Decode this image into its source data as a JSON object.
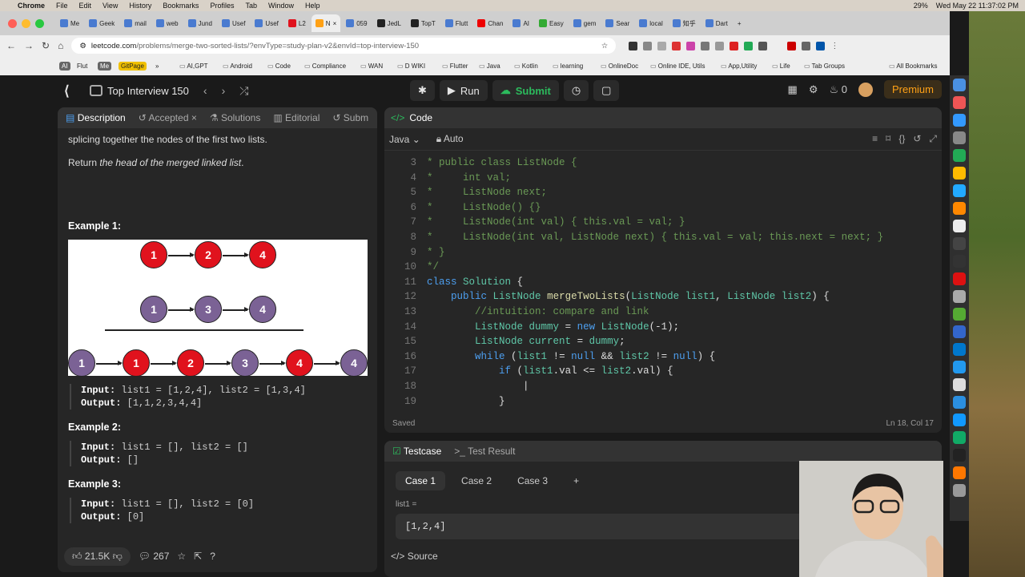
{
  "menubar": {
    "app": "Chrome",
    "items": [
      "File",
      "Edit",
      "View",
      "History",
      "Bookmarks",
      "Profiles",
      "Tab",
      "Window",
      "Help"
    ],
    "battery": "29%",
    "datetime": "Wed May 22 11:37:02 PM"
  },
  "tabs": [
    "Me",
    "Geek",
    "mail",
    "web",
    "Jund",
    "Usef",
    "Usef",
    "L2",
    "N",
    "059",
    "JedL",
    "TopT",
    "Flutt",
    "Chan",
    "AI",
    "Easy",
    "gem",
    "Sear",
    "local",
    "知乎",
    "Dart"
  ],
  "address": {
    "host": "leetcode.com",
    "path": "/problems/merge-two-sorted-lists/?envType=study-plan-v2&envId=top-interview-150"
  },
  "bookmarks": [
    "AI",
    "Flut",
    "Me",
    "GitPage",
    "AI,GPT",
    "Android",
    "Code",
    "Compliance",
    "WAN",
    "D WIKI",
    "Flutter",
    "Java",
    "Kotlin",
    "learning",
    "OnlineDoc",
    "Online IDE, Utils",
    "App,Utility",
    "Life",
    "Tab Groups",
    "All Bookmarks"
  ],
  "lc": {
    "list_title": "Top Interview 150",
    "run": "Run",
    "submit": "Submit",
    "streak": "0",
    "premium": "Premium"
  },
  "left_tabs": {
    "description": "Description",
    "accepted": "Accepted",
    "solutions": "Solutions",
    "editorial": "Editorial",
    "submissions": "Subm"
  },
  "description": {
    "p1": "splicing together the nodes of the first two lists.",
    "p2_a": "Return ",
    "p2_b": "the head of the merged linked list",
    "p2_c": ".",
    "ex1_title": "Example 1:",
    "ex1_in": "list1 = [1,2,4], list2 = [1,3,4]",
    "ex1_out": "[1,1,2,3,4,4]",
    "ex2_title": "Example 2:",
    "ex2_in": "list1 = [], list2 = []",
    "ex2_out": "[]",
    "ex3_title": "Example 3:",
    "ex3_in": "list1 = [], list2 = [0]",
    "ex3_out": "[0]",
    "input_label": "Input:",
    "output_label": "Output:"
  },
  "figure": {
    "row1": [
      "1",
      "2",
      "4"
    ],
    "row2": [
      "1",
      "3",
      "4"
    ],
    "row3": [
      "1",
      "1",
      "2",
      "3",
      "4",
      "4"
    ]
  },
  "likes": {
    "count": "21.5K",
    "comments": "267"
  },
  "code": {
    "title": "Code",
    "lang": "Java",
    "mode": "Auto",
    "saved": "Saved",
    "cursor": "Ln 18, Col 17"
  },
  "code_lines": [
    {
      "n": "3",
      "t": "* public class ListNode {"
    },
    {
      "n": "4",
      "t": "*     int val;"
    },
    {
      "n": "5",
      "t": "*     ListNode next;"
    },
    {
      "n": "6",
      "t": "*     ListNode() {}"
    },
    {
      "n": "7",
      "t": "*     ListNode(int val) { this.val = val; }"
    },
    {
      "n": "8",
      "t": "*     ListNode(int val, ListNode next) { this.val = val; this.next = next; }"
    },
    {
      "n": "9",
      "t": "* }"
    },
    {
      "n": "10",
      "t": "*/"
    },
    {
      "n": "11",
      "t": "class Solution {"
    },
    {
      "n": "12",
      "t": "    public ListNode mergeTwoLists(ListNode list1, ListNode list2) {"
    },
    {
      "n": "13",
      "t": "        //intuition: compare and link"
    },
    {
      "n": "14",
      "t": "        ListNode dummy = new ListNode(-1);"
    },
    {
      "n": "15",
      "t": "        ListNode current = dummy;"
    },
    {
      "n": "16",
      "t": "        while (list1 != null && list2 != null) {"
    },
    {
      "n": "17",
      "t": "            if (list1.val <= list2.val) {"
    },
    {
      "n": "18",
      "t": "                |"
    },
    {
      "n": "19",
      "t": "            }"
    }
  ],
  "testcase": {
    "tab": "Testcase",
    "result": "Test Result",
    "cases": [
      "Case 1",
      "Case 2",
      "Case 3"
    ],
    "label": "list1 =",
    "value": "[1,2,4]",
    "source": "Source"
  }
}
